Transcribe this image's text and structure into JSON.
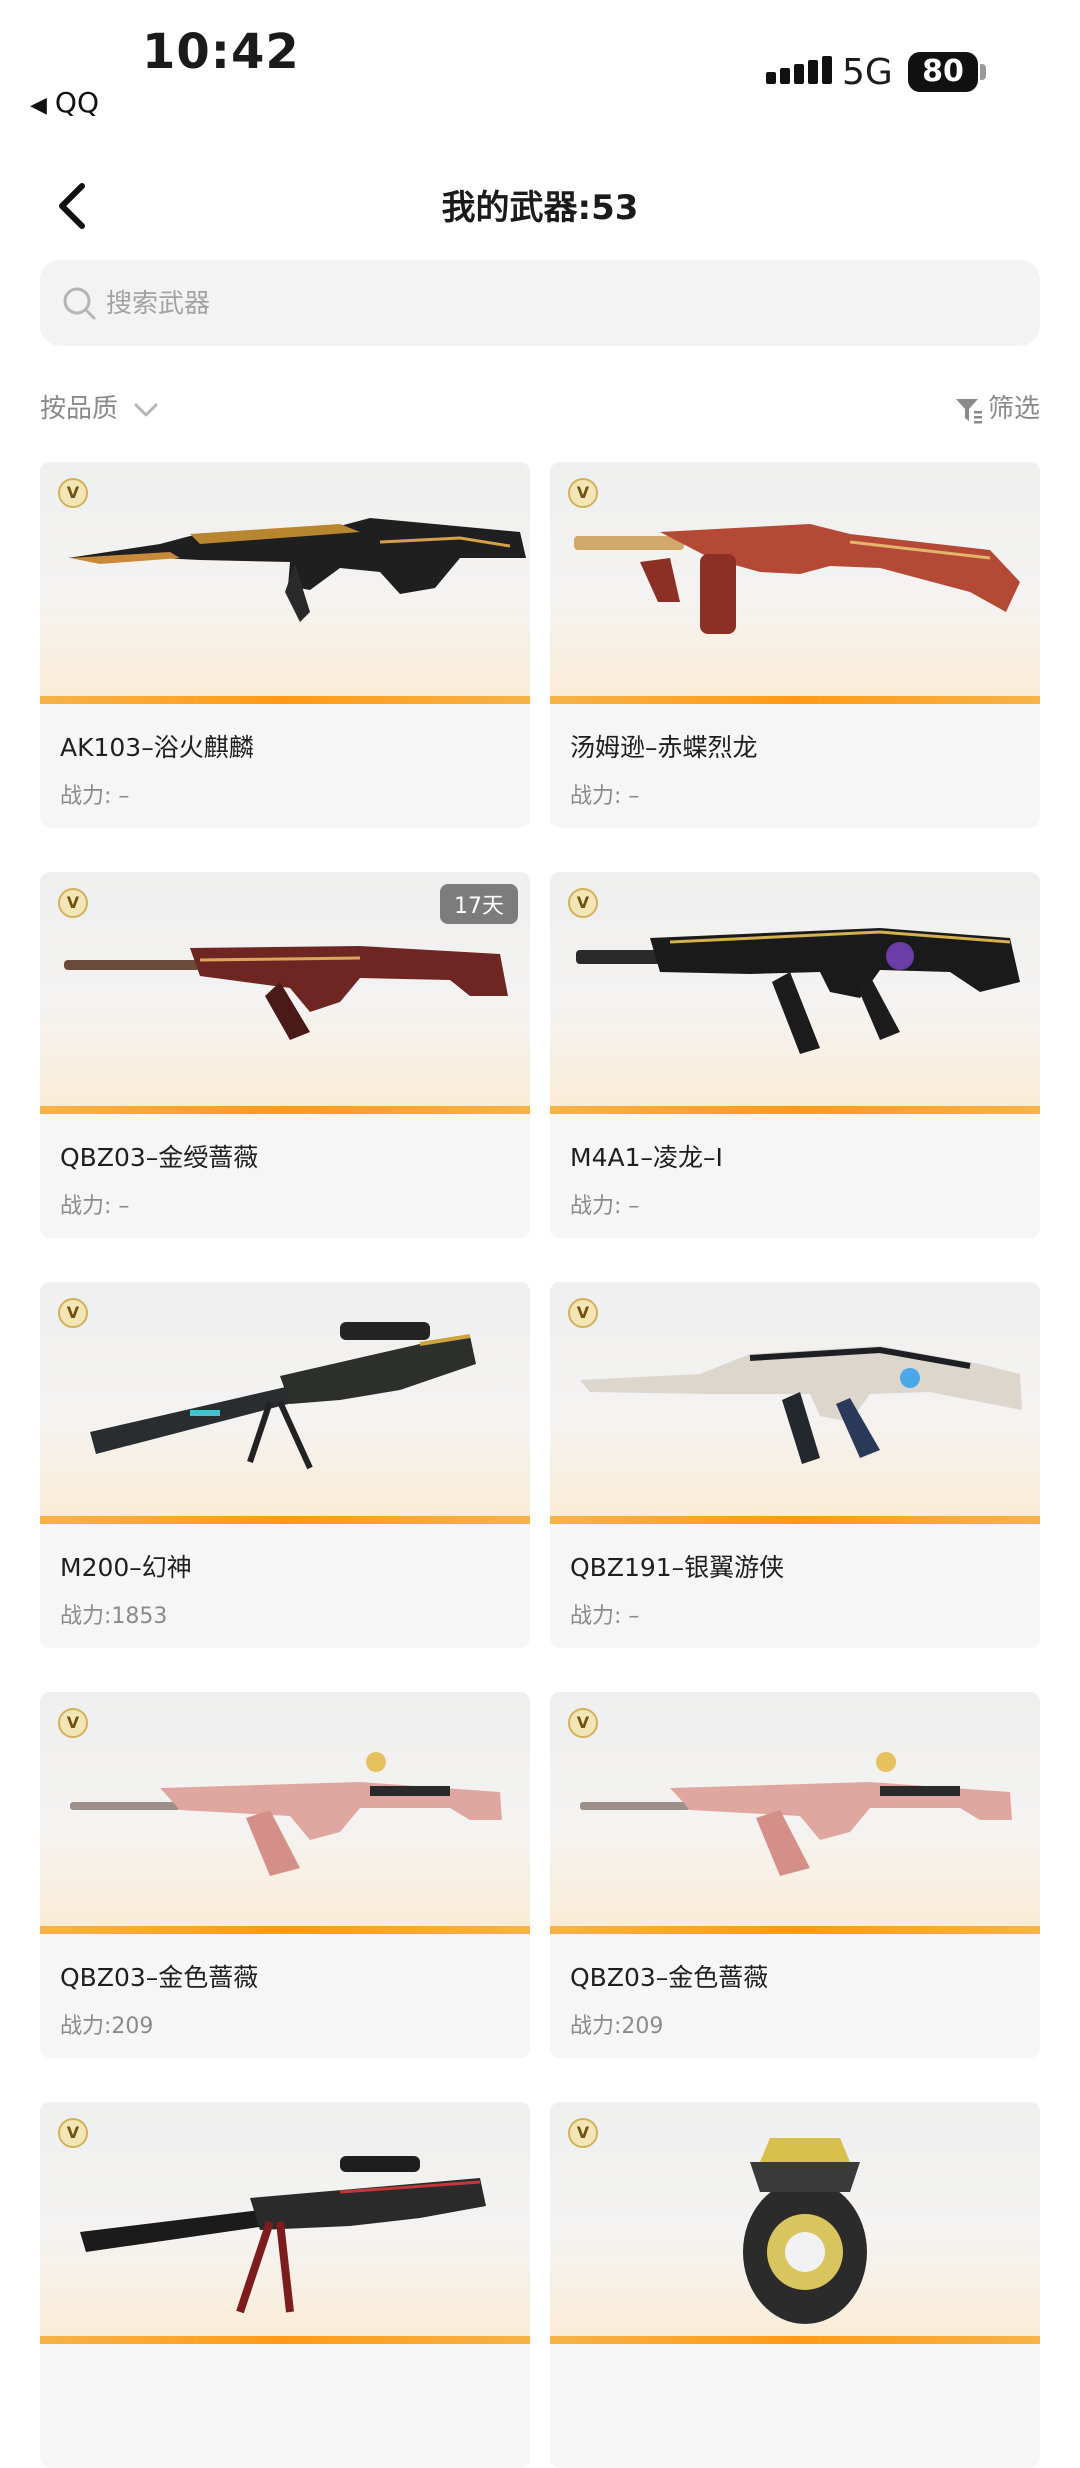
{
  "status": {
    "time": "10:42",
    "back_app": "QQ",
    "network": "5G",
    "battery": "80"
  },
  "header": {
    "title": "我的武器:53"
  },
  "search": {
    "placeholder": "搜索武器"
  },
  "toolbar": {
    "sort_label": "按品质",
    "filter_label": "筛选"
  },
  "badge_letter": "V",
  "weapons": [
    {
      "name": "AK103–浴火麒麟",
      "power": "战力: –",
      "days": ""
    },
    {
      "name": "汤姆逊–赤蝶烈龙",
      "power": "战力: –",
      "days": ""
    },
    {
      "name": "QBZ03–金绶蔷薇",
      "power": "战力: –",
      "days": "17天"
    },
    {
      "name": "M4A1–凌龙–I",
      "power": "战力: –",
      "days": ""
    },
    {
      "name": "M200–幻神",
      "power": "战力:1853",
      "days": ""
    },
    {
      "name": "QBZ191–银翼游侠",
      "power": "战力: –",
      "days": ""
    },
    {
      "name": "QBZ03–金色蔷薇",
      "power": "战力:209",
      "days": ""
    },
    {
      "name": "QBZ03–金色蔷薇",
      "power": "战力:209",
      "days": ""
    },
    {
      "name": "",
      "power": "",
      "days": ""
    },
    {
      "name": "",
      "power": "",
      "days": ""
    }
  ],
  "colors": {
    "accent_bar": "#ff9a16",
    "card_bg": "#f6f6f6",
    "muted_text": "#8b8b8b"
  }
}
